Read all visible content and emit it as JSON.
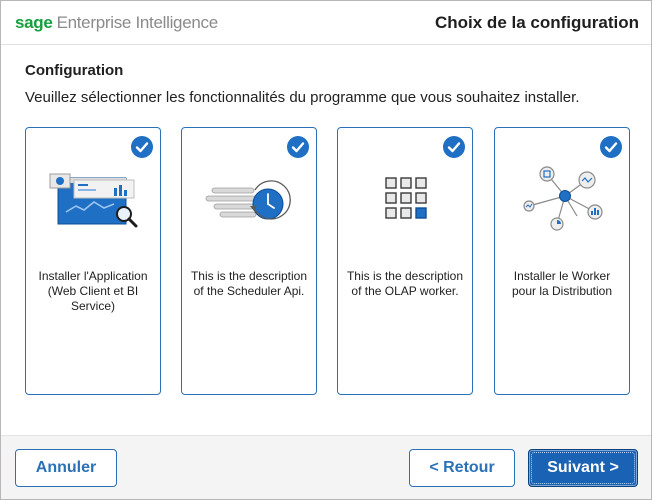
{
  "header": {
    "brand_sage": "sage",
    "brand_product": "Enterprise Intelligence",
    "step_title": "Choix de la configuration"
  },
  "main": {
    "section_title": "Configuration",
    "instructions": "Veuillez sélectionner les fonctionnalités du programme que vous souhaitez installer.",
    "features": [
      {
        "icon": "web-dashboard-icon",
        "description": "Installer l'Application (Web Client et BI Service)",
        "selected": true
      },
      {
        "icon": "scheduler-clock-icon",
        "description": "This is the description of the Scheduler Api.",
        "selected": true
      },
      {
        "icon": "olap-grid-icon",
        "description": "This is the description of the OLAP worker.",
        "selected": true
      },
      {
        "icon": "network-nodes-icon",
        "description": "Installer le Worker pour la Distribution",
        "selected": true
      }
    ]
  },
  "footer": {
    "cancel_label": "Annuler",
    "back_label": "< Retour",
    "next_label": "Suivant >"
  },
  "colors": {
    "brand_green": "#15a03c",
    "accent_blue": "#1f6fc4",
    "card_border": "#2b71b8"
  }
}
